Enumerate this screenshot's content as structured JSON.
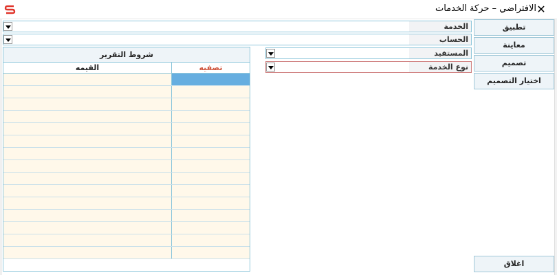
{
  "window": {
    "title": "الافتراضي – حركة الخدمات",
    "close_glyph": "✕",
    "app_icon": "s-logo-icon",
    "brand_color": "#e0342a"
  },
  "fields": {
    "service": "الخدمة",
    "account": "الحساب",
    "beneficiary": "المستفيد",
    "service_type": "نوع الخدمة"
  },
  "buttons": {
    "apply": "تطبيق",
    "preview": "معاينة",
    "design": "تصميم",
    "choose_design": "اختيار التصميم",
    "close": "اغلاق"
  },
  "report_conditions": {
    "caption": "شروط التقرير",
    "columns": {
      "filter": "تصفيه",
      "value": "القيمه"
    },
    "rows": [
      "",
      "",
      "",
      "",
      "",
      "",
      "",
      "",
      "",
      "",
      "",
      "",
      "",
      "",
      ""
    ]
  },
  "colors": {
    "border": "#8fc7db",
    "row_fill": "#fff8ea",
    "selected_cell": "#66aee0",
    "filter_header": "#d0573f",
    "service_type_border": "#d08080"
  }
}
